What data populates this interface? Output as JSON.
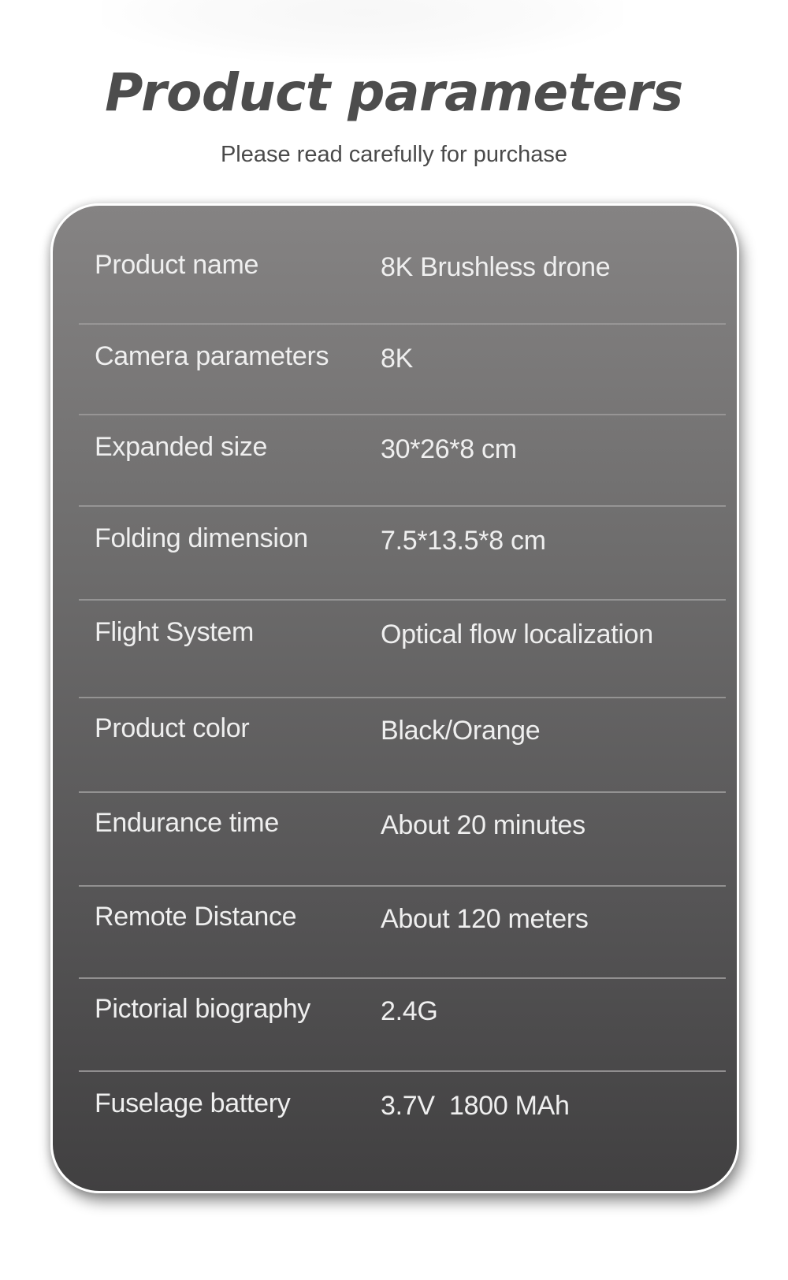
{
  "header": {
    "title": "Product parameters",
    "subtitle": "Please read carefully for purchase"
  },
  "specs": [
    {
      "label": "Product name",
      "value": "8K Brushless drone"
    },
    {
      "label": "Camera parameters",
      "value": "8K"
    },
    {
      "label": "Expanded size",
      "value": "30*26*8 cm"
    },
    {
      "label": "Folding dimension",
      "value": "7.5*13.5*8 cm"
    },
    {
      "label": "Flight System",
      "value": "Optical flow localization"
    },
    {
      "label": "Product color",
      "value": "Black/Orange"
    },
    {
      "label": "Endurance time",
      "value": "About 20 minutes"
    },
    {
      "label": "Remote Distance",
      "value": "About 120 meters"
    },
    {
      "label": "Pictorial biography",
      "value": "2.4G"
    },
    {
      "label": "Fuselage battery",
      "value": "3.7V  1800 MAh"
    }
  ],
  "colors": {
    "card_top": "#858383",
    "card_bottom": "#414041",
    "title": "#4d4d4d",
    "spec_text": "#efefef",
    "divider": "#9c9b9b"
  }
}
